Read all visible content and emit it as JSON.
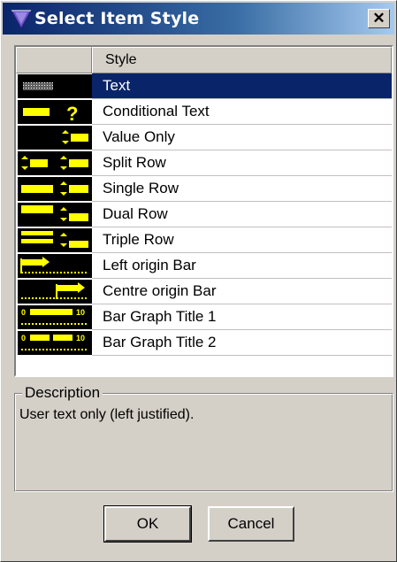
{
  "window": {
    "title": "Select Item Style",
    "close_glyph": "✕"
  },
  "list": {
    "columns": [
      "",
      "Style"
    ],
    "selected_index": 0,
    "items": [
      {
        "label": "Text",
        "icon": "text-pattern-icon"
      },
      {
        "label": "Conditional Text",
        "icon": "conditional-text-icon"
      },
      {
        "label": "Value Only",
        "icon": "value-only-icon"
      },
      {
        "label": "Split Row",
        "icon": "split-row-icon"
      },
      {
        "label": "Single Row",
        "icon": "single-row-icon"
      },
      {
        "label": "Dual Row",
        "icon": "dual-row-icon"
      },
      {
        "label": "Triple Row",
        "icon": "triple-row-icon"
      },
      {
        "label": "Left origin Bar",
        "icon": "left-origin-bar-icon"
      },
      {
        "label": "Centre origin Bar",
        "icon": "centre-origin-bar-icon"
      },
      {
        "label": "Bar Graph Title 1",
        "icon": "bar-graph-title-1-icon"
      },
      {
        "label": "Bar Graph Title 2",
        "icon": "bar-graph-title-2-icon"
      }
    ],
    "icon_glyphs": {
      "question": "?",
      "arrows": "⇕",
      "scale_start": "0",
      "scale_end": "10"
    }
  },
  "description": {
    "legend": "Description",
    "text": "User text only (left justified)."
  },
  "buttons": {
    "ok": "OK",
    "cancel": "Cancel"
  },
  "colors": {
    "icon_bg": "#000000",
    "icon_fg": "#ffff00",
    "selection": "#0a246a"
  }
}
